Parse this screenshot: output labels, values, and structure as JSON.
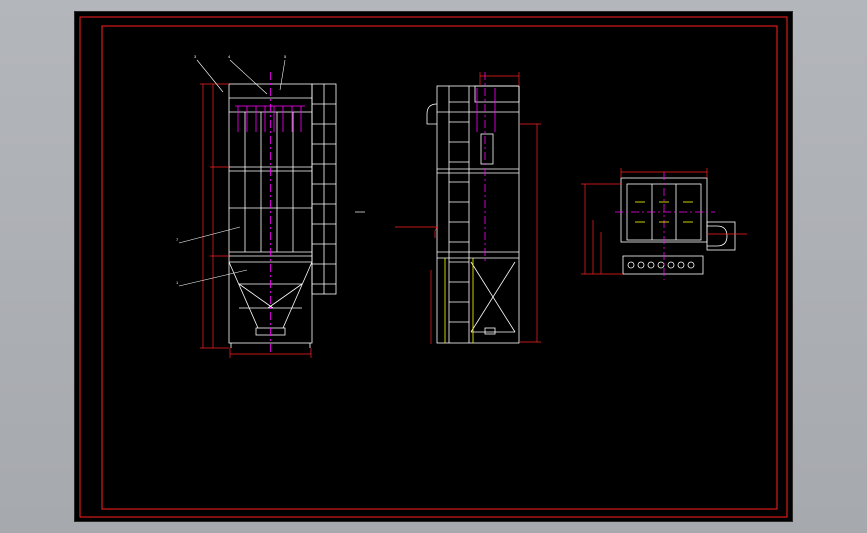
{
  "drawing": {
    "front_view": {
      "callouts": [
        "3",
        "4",
        "5",
        "7",
        "1"
      ],
      "dims_left": [
        "",
        "",
        "",
        "",
        ""
      ],
      "dim_bottom": ""
    },
    "side_view": {
      "top_label": "",
      "dim_top": "",
      "note": "",
      "dim_right": "",
      "dim_left": ""
    },
    "plan_view": {
      "title": "",
      "dim_top": "",
      "dims_left": [
        "",
        "",
        ""
      ]
    },
    "center_mark": ""
  },
  "colors": {
    "sheet": "#000000",
    "border": "#ff2020",
    "geometry": "#ffffff",
    "dimension": "#ff2020",
    "centerline": "#ff00ff",
    "hidden": "#ffff00"
  }
}
